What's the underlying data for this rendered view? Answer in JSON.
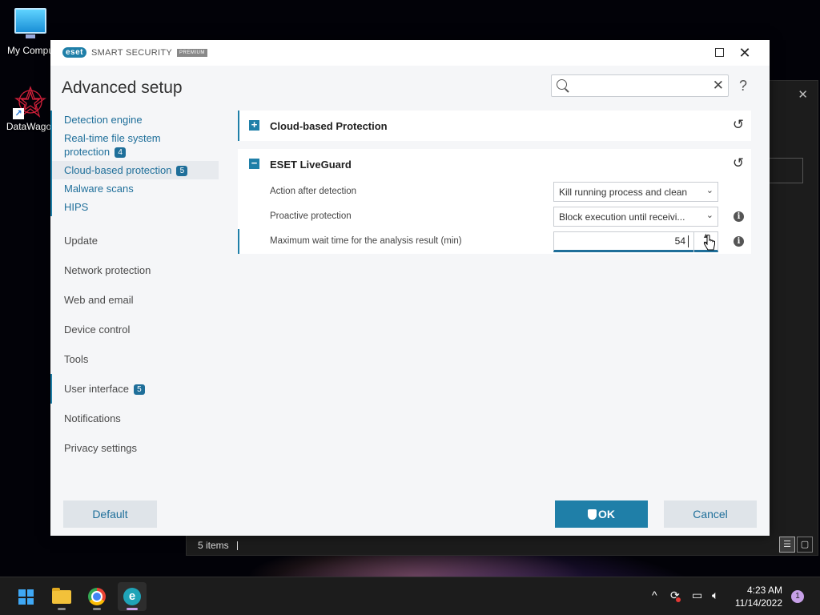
{
  "desktop": {
    "icons": [
      {
        "label": "My Compu"
      },
      {
        "label": "DataWagor"
      }
    ]
  },
  "background_window": {
    "status_text": "5 items"
  },
  "eset": {
    "logo_text": "eset",
    "brand": "SMART SECURITY",
    "edition": "PREMIUM",
    "page_title": "Advanced setup",
    "search": {
      "value": "",
      "placeholder": ""
    },
    "sidebar": {
      "detection_group": [
        {
          "label": "Detection engine"
        },
        {
          "label": "Real-time file system protection",
          "badge": "4"
        },
        {
          "label": "Cloud-based protection",
          "badge": "5",
          "active": true
        },
        {
          "label": "Malware scans"
        },
        {
          "label": "HIPS"
        }
      ],
      "items": [
        {
          "label": "Update"
        },
        {
          "label": "Network protection"
        },
        {
          "label": "Web and email"
        },
        {
          "label": "Device control"
        },
        {
          "label": "Tools"
        },
        {
          "label": "User interface",
          "badge": "5"
        },
        {
          "label": "Notifications"
        },
        {
          "label": "Privacy settings"
        }
      ]
    },
    "sections": {
      "cloud": {
        "title": "Cloud-based Protection",
        "expanded": false
      },
      "liveguard": {
        "title": "ESET LiveGuard",
        "expanded": true,
        "rows": [
          {
            "label": "Action after detection",
            "value": "Kill running process and clean"
          },
          {
            "label": "Proactive protection",
            "value": "Block execution until receivi..."
          },
          {
            "label": "Maximum wait time for the analysis result (min)",
            "value": "54"
          }
        ]
      }
    },
    "buttons": {
      "default": "Default",
      "ok": "OK",
      "cancel": "Cancel"
    }
  },
  "taskbar": {
    "clock_time": "4:23 AM",
    "clock_date": "11/14/2022",
    "notification_count": "1"
  },
  "colors": {
    "accent": "#1f7fa8",
    "link": "#1f6f9a"
  }
}
